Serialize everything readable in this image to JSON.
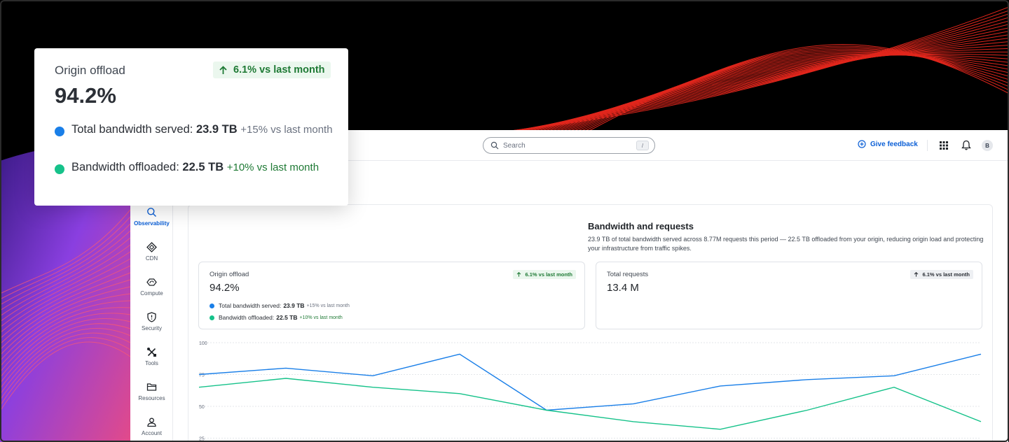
{
  "colors": {
    "accent": "#0b5fd6",
    "series_total": "#1a7fe8",
    "series_offloaded": "#16c28a",
    "positive": "#1f7a35",
    "wave_red": "#e0261c",
    "wave_purple": "#7b3bd6"
  },
  "topbar": {
    "search_placeholder": "Search",
    "search_shortcut": "/",
    "feedback_label": "Give feedback",
    "avatar_initial": "B",
    "icons": [
      "search-icon",
      "feedback-icon",
      "apps-grid-icon",
      "bell-icon"
    ]
  },
  "sidebar": {
    "items": [
      {
        "label": "Observability",
        "icon": "search-icon",
        "active": true
      },
      {
        "label": "CDN",
        "icon": "diamond-icon"
      },
      {
        "label": "Compute",
        "icon": "cloud-icon"
      },
      {
        "label": "Security",
        "icon": "shield-icon"
      },
      {
        "label": "Tools",
        "icon": "tools-icon"
      },
      {
        "label": "Resources",
        "icon": "folder-icon"
      },
      {
        "label": "Account",
        "icon": "user-icon"
      }
    ]
  },
  "section": {
    "title": "Bandwidth and requests",
    "description": "23.9 TB of total bandwidth served across 8.77M requests this period — 22.5 TB offloaded from your origin, reducing origin load and protecting your infrastructure from traffic spikes."
  },
  "origin_offload": {
    "label": "Origin offload",
    "value": "94.2%",
    "trend": "6.1% vs last month",
    "total_label": "Total bandwidth served:",
    "total_value": "23.9 TB",
    "total_delta": "+15% vs last month",
    "offloaded_label": "Bandwidth offloaded:",
    "offloaded_value": "22.5 TB",
    "offloaded_delta": "+10% vs last month"
  },
  "total_requests": {
    "label": "Total requests",
    "value": "13.4 M",
    "trend": "6.1% vs last month"
  },
  "callout": {
    "label": "Origin offload",
    "value": "94.2%",
    "trend": "6.1% vs last month",
    "total_label": "Total bandwidth served:",
    "total_value": "23.9 TB",
    "total_delta": "+15% vs last month",
    "offloaded_label": "Bandwidth offloaded:",
    "offloaded_value": "22.5 TB",
    "offloaded_delta": "+10% vs last month"
  },
  "chart_data": {
    "type": "line",
    "x": [
      0,
      1,
      2,
      3,
      4,
      5,
      6,
      7,
      8,
      9,
      10
    ],
    "yticks": [
      100,
      75,
      50,
      25
    ],
    "ylim": [
      22,
      100
    ],
    "grid": true,
    "series": [
      {
        "color": "#1a7fe8",
        "values": [
          75,
          80,
          74,
          91,
          47,
          52,
          66,
          71,
          74,
          91
        ]
      },
      {
        "color": "#16c28a",
        "values": [
          65,
          72,
          65,
          60,
          47,
          38,
          32,
          47,
          65,
          38
        ]
      }
    ]
  }
}
